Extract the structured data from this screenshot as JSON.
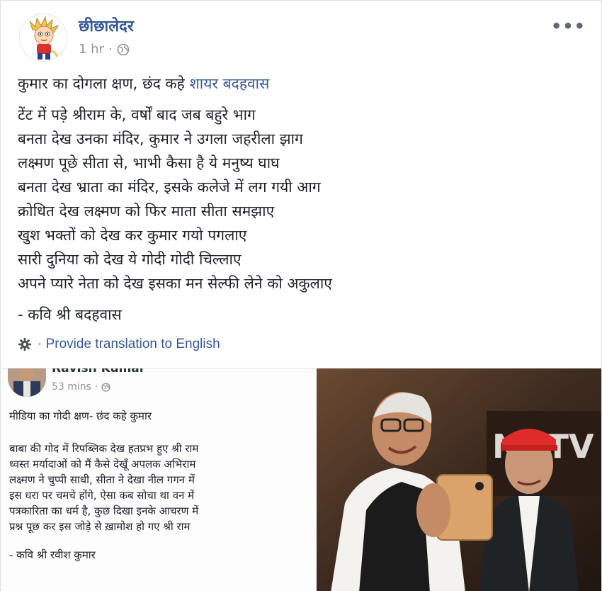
{
  "post": {
    "author": "छीछालेदर",
    "time": "1 hr",
    "dot": "·",
    "more": "•••",
    "headline_prefix": "कुमार का दोगला क्षण, छंद कहे",
    "headline_link": "शायर बदहवास",
    "poem": [
      "टेंट में पड़े श्रीराम के, वर्षों बाद जब बहुरे भाग",
      "बनता देख उनका मंदिर, कुमार ने उगला जहरीला झाग",
      "लक्ष्मण पूछे सीता से, भाभी कैसा है ये मनुष्य घाघ",
      "बनता देख भ्राता का मंदिर, इसके कलेजे में लग गयी आग",
      "क्रोधित देख लक्ष्मण को फिर माता सीता समझाए",
      "खुश भक्तों को देख कर कुमार गयो पगलाए",
      "सारी दुनिया को देख ये गोदी गोदी चिल्लाए",
      "अपने प्यारे नेता को देख इसका मन सेल्फी लेने को अकुलाए"
    ],
    "signature": "- कवि श्री बदहवास",
    "translate_label": "· Provide translation to English",
    "icons": {
      "globe": "globe-icon",
      "gear": "gear-icon",
      "more": "more-options-icon"
    },
    "colors": {
      "link": "#365899",
      "meta": "#90949c",
      "text": "#1d2129"
    }
  },
  "embedded": {
    "author": "Ravish Kumar",
    "time": "53 mins",
    "dot": "·",
    "title": "मीडिया का गोदी क्षण- छंद कहे कुमार",
    "poem": [
      "बाबा की गोद में रिपब्लिक देख हतप्रभ हुए श्री राम",
      "ध्वस्त मर्यादाओं को मैं कैसे देखूँ अपलक अभिराम",
      "लक्ष्मण ने चुप्पी साधी, सीता ने देखा नील गगन में",
      "इस धरा पर चमचे होंगे, ऐसा कब सोचा था वन में",
      "पत्रकारिता का धर्म है, कुछ दिखा इनके आचरण में",
      "प्रश्न पूछ कर इस जोड़े से ख़ामोश हो गए श्री राम"
    ],
    "signature": "- कवि श्री रवीश कुमार",
    "photo_backdrop_text": "NDTV"
  }
}
